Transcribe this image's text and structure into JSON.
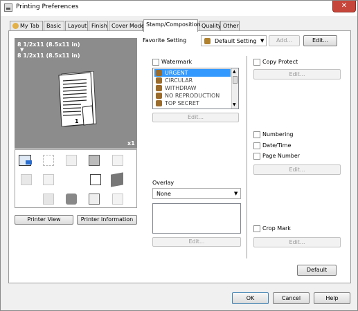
{
  "window": {
    "title": "Printing Preferences",
    "close_glyph": "✕"
  },
  "tabs": [
    "My Tab",
    "Basic",
    "Layout",
    "Finish",
    "Cover Mode",
    "Stamp/Composition",
    "Quality",
    "Other"
  ],
  "active_tab": "Stamp/Composition",
  "favorite": {
    "label": "Favorite Setting",
    "value": "Default Setting",
    "add_label": "Add...",
    "edit_label": "Edit..."
  },
  "preview": {
    "line1": "8 1/2x11 (8.5x11 in)",
    "arrow": "▼",
    "line2": "8 1/2x11 (8.5x11 in)",
    "copies": "x1",
    "page_number": "1"
  },
  "left_buttons": {
    "printer_view": "Printer View",
    "printer_info": "Printer Information"
  },
  "watermark": {
    "label": "Watermark",
    "items": [
      "URGENT",
      "CIRCULAR",
      "WITHDRAW",
      "NO REPRODUCTION",
      "TOP SECRET"
    ],
    "selected_index": 0,
    "edit_label": "Edit..."
  },
  "overlay": {
    "label": "Overlay",
    "value": "None",
    "edit_label": "Edit..."
  },
  "copy_protect": {
    "label": "Copy Protect",
    "edit_label": "Edit..."
  },
  "numbering": {
    "numbering_label": "Numbering",
    "datetime_label": "Date/Time",
    "page_number_label": "Page Number",
    "edit_label": "Edit..."
  },
  "crop_mark": {
    "label": "Crop Mark",
    "edit_label": "Edit..."
  },
  "default_label": "Default",
  "dialog_buttons": {
    "ok": "OK",
    "cancel": "Cancel",
    "help": "Help"
  }
}
